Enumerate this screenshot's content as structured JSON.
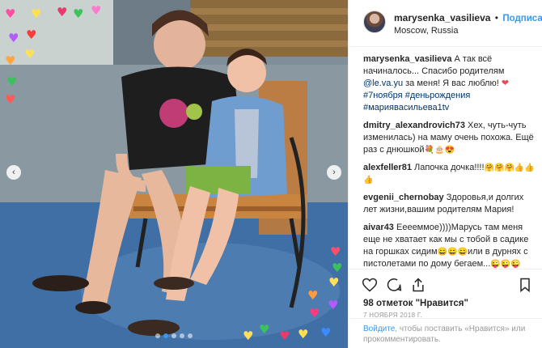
{
  "post": {
    "username": "marysenka_vasilieva",
    "follow_label": "Подписаться",
    "separator": "•",
    "location": "Moscow, Russia",
    "photo_description_icon": "photo-of-mother-and-daughter-on-bench"
  },
  "comments": [
    {
      "user": "marysenka_vasilieva",
      "text_before": " А так всё начиналось... Спасибо родителям ",
      "mention": "@le.va.yu",
      "text_after": " за меня! Я вас люблю! ",
      "heart": "❤",
      "tag1": "#7ноября",
      "tag2": "#деньрождения",
      "tag3": "#мариявасильева1tv"
    },
    {
      "user": "dmitry_alexandrovich73",
      "text": " Хех, чуть-чуть изменилась) на маму очень похожа. Ещё раз с днюшкой",
      "emoji": "💐🎂😍"
    },
    {
      "user": "alexfeller81",
      "text": " Лапочка дочка!!!!",
      "emoji": "🤗🤗🤗👍👍👍"
    },
    {
      "user": "evgenii_chernobay",
      "text": " Здоровья,и долгих лет жизни,вашим родителям Мария!"
    },
    {
      "user": "aivar43",
      "text1": " Ееееммое))))Марусь там меня еще не хватает как мы с тобой в садике на горшках сидим",
      "emoji1": "😄😄😄",
      "text2": "или в дурнях с пистолетами по дому бегаем...",
      "emoji2": "😜😜😜"
    }
  ],
  "actions": {
    "likes": "98 отметок \"Нравится\"",
    "date": "7 НОЯБРЯ 2018 Г."
  },
  "login_note": {
    "link": "Войдите",
    "text": ", чтобы поставить «Нравится» или прокомментировать."
  },
  "colors": {
    "accent": "#3897f0",
    "link": "#003569",
    "heart": "#ed4956"
  }
}
